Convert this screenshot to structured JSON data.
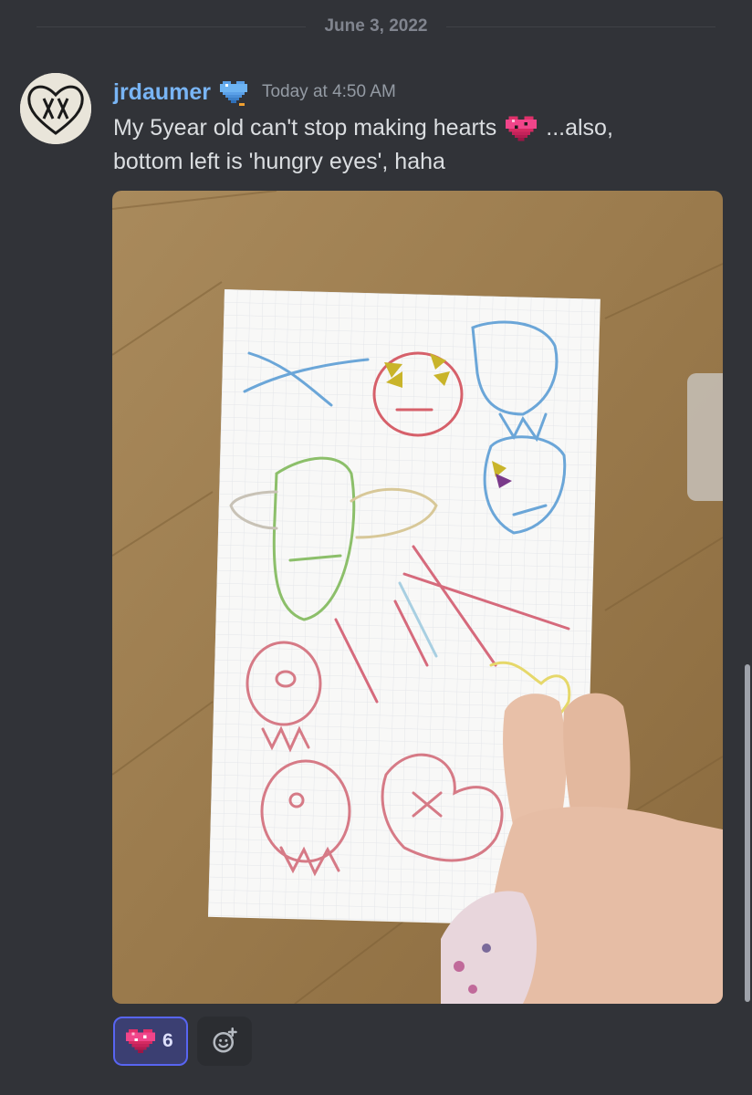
{
  "divider": {
    "date": "June 3, 2022"
  },
  "message": {
    "author": "jrdaumer",
    "author_color": "#79b5f5",
    "badge_icon": "pixel-heart-blue-icon",
    "timestamp": "Today at 4:50 AM",
    "text_line1_a": "My 5year old can't stop making hearts",
    "inline_emoji": "pixel-heart-pink-icon",
    "text_line1_b": "...also,",
    "text_line2": "bottom left is 'hungry eyes', haha",
    "attachment": {
      "kind": "photo",
      "subject": "child's crayon drawings of hearts and faces on graph paper"
    }
  },
  "reactions": [
    {
      "emoji": "pixel-heart-pink-icon",
      "count": "6",
      "active": true
    }
  ],
  "add_reaction": {
    "icon": "smiley-plus-icon"
  },
  "colors": {
    "background": "#313338",
    "accent": "#5865f2"
  }
}
